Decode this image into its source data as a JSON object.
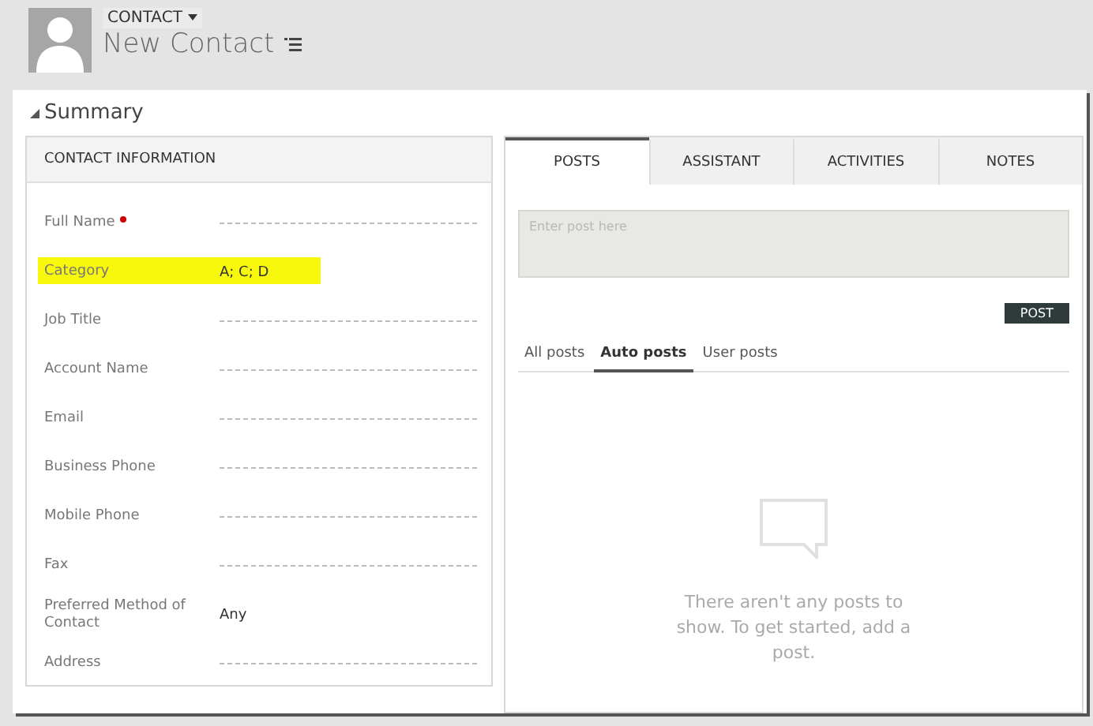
{
  "header": {
    "entity_menu": "CONTACT",
    "title": "New Contact"
  },
  "section": {
    "title": "Summary",
    "expanded": true
  },
  "contact_info": {
    "title": "CONTACT INFORMATION",
    "fields": [
      {
        "label": "Full Name",
        "required": true,
        "kind": "empty",
        "highlighted": false
      },
      {
        "label": "Category",
        "required": false,
        "kind": "value",
        "value": "A; C; D",
        "highlighted": true
      },
      {
        "label": "Job Title",
        "required": false,
        "kind": "empty",
        "highlighted": false
      },
      {
        "label": "Account Name",
        "required": false,
        "kind": "empty",
        "highlighted": false
      },
      {
        "label": "Email",
        "required": false,
        "kind": "empty",
        "highlighted": false
      },
      {
        "label": "Business Phone",
        "required": false,
        "kind": "empty",
        "highlighted": false
      },
      {
        "label": "Mobile Phone",
        "required": false,
        "kind": "empty",
        "highlighted": false
      },
      {
        "label": "Fax",
        "required": false,
        "kind": "empty",
        "highlighted": false
      },
      {
        "label": "Preferred Method of Contact",
        "required": false,
        "kind": "value",
        "value": "Any",
        "highlighted": false
      },
      {
        "label": "Address",
        "required": false,
        "kind": "empty",
        "highlighted": false
      }
    ]
  },
  "tabs": [
    {
      "label": "POSTS",
      "selected": true
    },
    {
      "label": "ASSISTANT",
      "selected": false
    },
    {
      "label": "ACTIVITIES",
      "selected": false
    },
    {
      "label": "NOTES",
      "selected": false
    }
  ],
  "post_box": {
    "placeholder": "Enter post here"
  },
  "post_button": "POST",
  "post_filters": [
    {
      "label": "All posts",
      "selected": false
    },
    {
      "label": "Auto posts",
      "selected": true
    },
    {
      "label": "User posts",
      "selected": false
    }
  ],
  "empty_message": "There aren't any posts to show. To get started, add a post."
}
